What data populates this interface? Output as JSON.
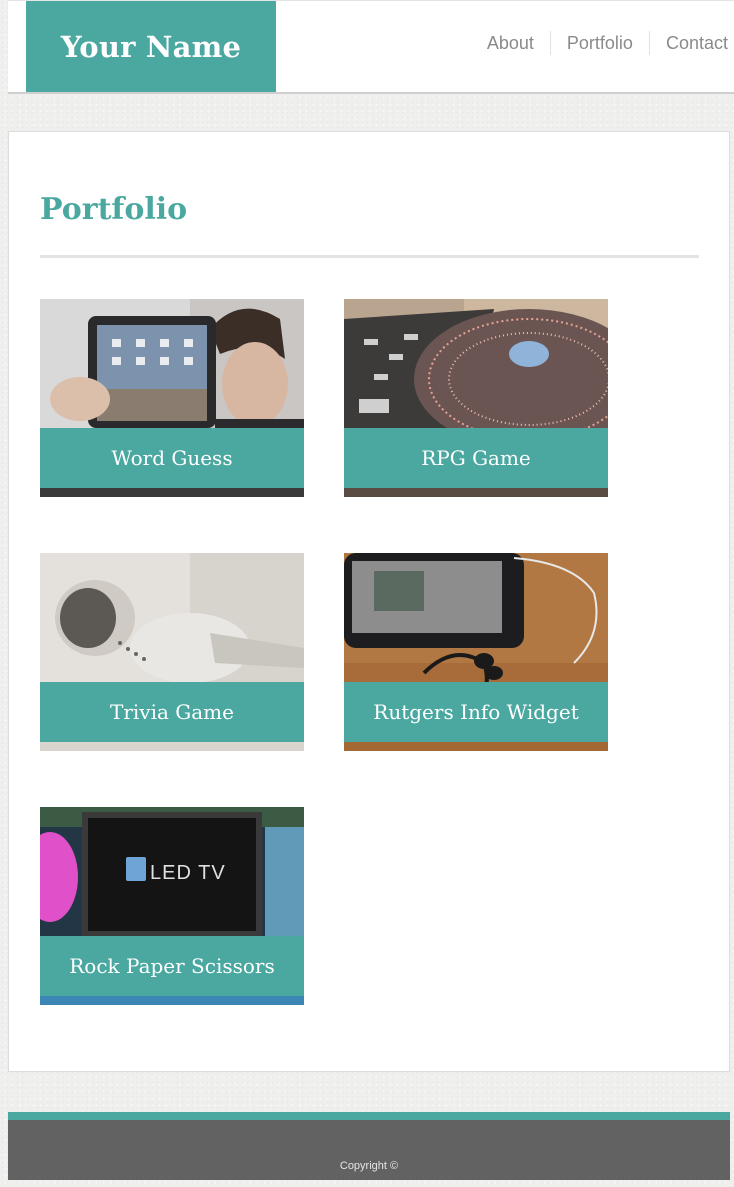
{
  "header": {
    "brand": "Your Name",
    "nav": [
      "About",
      "Portfolio",
      "Contact"
    ]
  },
  "page": {
    "title": "Portfolio"
  },
  "portfolio": {
    "items": [
      {
        "title": "Word Guess",
        "image": "tablet-photo"
      },
      {
        "title": "RPG Game",
        "image": "turntable-photo"
      },
      {
        "title": "Trivia Game",
        "image": "earbuds-photo"
      },
      {
        "title": "Rutgers Info Widget",
        "image": "smartphone-photo"
      },
      {
        "title": "Rock Paper Scissors",
        "image": "led-tv-photo"
      }
    ]
  },
  "footer": {
    "copyright": "Copyright ©"
  },
  "colors": {
    "accent": "#4aa8a0",
    "footer": "#626262",
    "nav_text": "#8a8a8a"
  }
}
